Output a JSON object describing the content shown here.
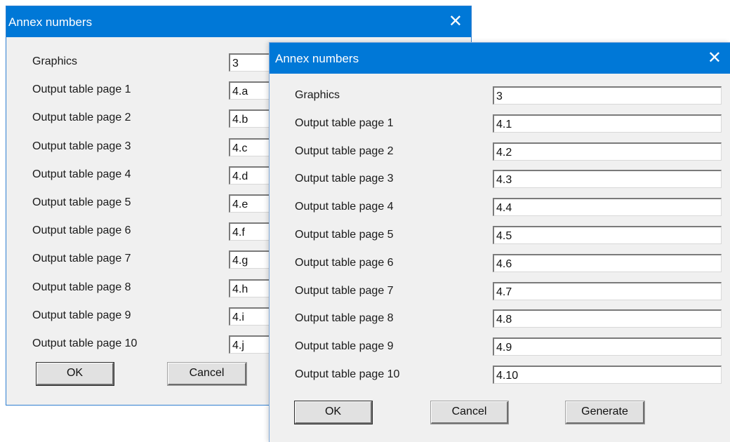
{
  "back_dialog": {
    "title": "Annex numbers",
    "close_glyph": "✕",
    "rows": [
      {
        "label": "Graphics",
        "value": "3"
      },
      {
        "label": "Output table page  1",
        "value": "4.a"
      },
      {
        "label": "Output table page  2",
        "value": "4.b"
      },
      {
        "label": "Output table page  3",
        "value": "4.c"
      },
      {
        "label": "Output table page  4",
        "value": "4.d"
      },
      {
        "label": "Output table page  5",
        "value": "4.e"
      },
      {
        "label": "Output table page  6",
        "value": "4.f"
      },
      {
        "label": "Output table page  7",
        "value": "4.g"
      },
      {
        "label": "Output table page  8",
        "value": "4.h"
      },
      {
        "label": "Output table page  9",
        "value": "4.i"
      },
      {
        "label": "Output table page 10",
        "value": "4.j"
      }
    ],
    "ok_label": "OK",
    "cancel_label": "Cancel"
  },
  "front_dialog": {
    "title": "Annex numbers",
    "close_glyph": "✕",
    "rows": [
      {
        "label": "Graphics",
        "value": "3"
      },
      {
        "label": "Output table page  1",
        "value": "4.1"
      },
      {
        "label": "Output table page  2",
        "value": "4.2"
      },
      {
        "label": "Output table page  3",
        "value": "4.3"
      },
      {
        "label": "Output table page  4",
        "value": "4.4"
      },
      {
        "label": "Output table page  5",
        "value": "4.5"
      },
      {
        "label": "Output table page  6",
        "value": "4.6"
      },
      {
        "label": "Output table page  7",
        "value": "4.7"
      },
      {
        "label": "Output table page  8",
        "value": "4.8"
      },
      {
        "label": "Output table page  9",
        "value": "4.9"
      },
      {
        "label": "Output table page 10",
        "value": "4.10"
      }
    ],
    "ok_label": "OK",
    "cancel_label": "Cancel",
    "generate_label": "Generate"
  },
  "colors": {
    "titlebar": "#0078d7",
    "dialog_bg": "#f0f0f0"
  },
  "icons": {
    "close": "close-icon"
  }
}
